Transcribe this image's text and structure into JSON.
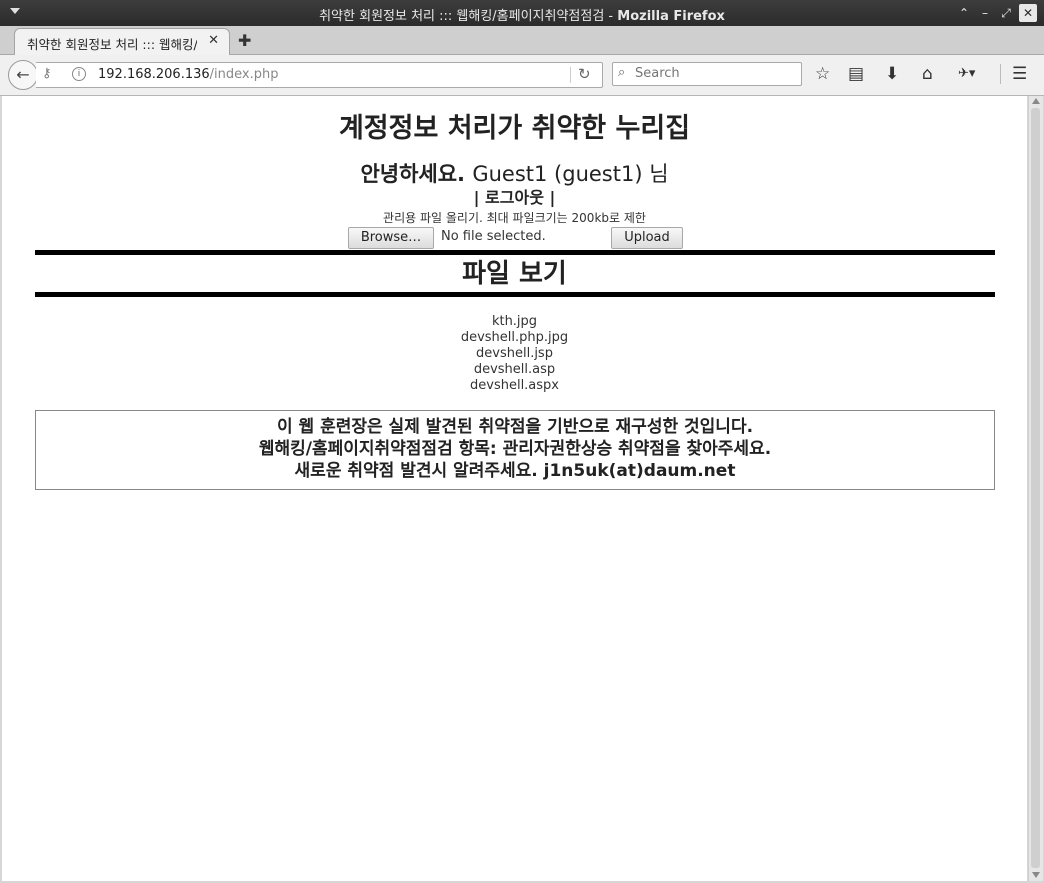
{
  "window": {
    "title_prefix": "취약한 회원정보 처리 ::: 웹해킹/홈페이지취약점점검 - ",
    "title_app": "Mozilla Firefox"
  },
  "tab": {
    "label": "취약한 회원정보 처리 ::: 웹해킹/홈페이지취약점점검",
    "close": "✕",
    "new_tab": "✚"
  },
  "nav": {
    "url_host": "192.168.206.136",
    "url_path": "/index.php",
    "search_placeholder": "Search"
  },
  "page": {
    "heading": "계정정보 처리가 취약한 누리집",
    "greeting_prefix": "안녕하세요. ",
    "greeting_user": "Guest1 (guest1)",
    "greeting_suffix": " 님",
    "logout": "| 로그아웃 |",
    "upload_note": "관리용 파일 올리기. 최대 파일크기는 200kb로 제한",
    "browse_label": "Browse…",
    "file_status": "No file selected.",
    "upload_label": "Upload",
    "file_view_heading": "파일 보기",
    "files": [
      "kth.jpg",
      "devshell.php.jpg",
      "devshell.jsp",
      "devshell.asp",
      "devshell.aspx"
    ],
    "notice": [
      "이 웹 훈련장은 실제 발견된 취약점을 기반으로 재구성한 것입니다.",
      "웹해킹/홈페이지취약점점검 항목: 관리자권한상승 취약점을 찾아주세요.",
      "새로운 취약점 발견시 알려주세요. j1n5uk(at)daum.net"
    ]
  },
  "icons": {
    "back": "back-arrow-icon",
    "reload": "reload-icon",
    "search": "search-icon",
    "bookmark": "star-icon",
    "reading_list": "clipboard-icon",
    "downloads": "download-icon",
    "home": "home-icon",
    "menu": "hamburger-menu-icon"
  }
}
